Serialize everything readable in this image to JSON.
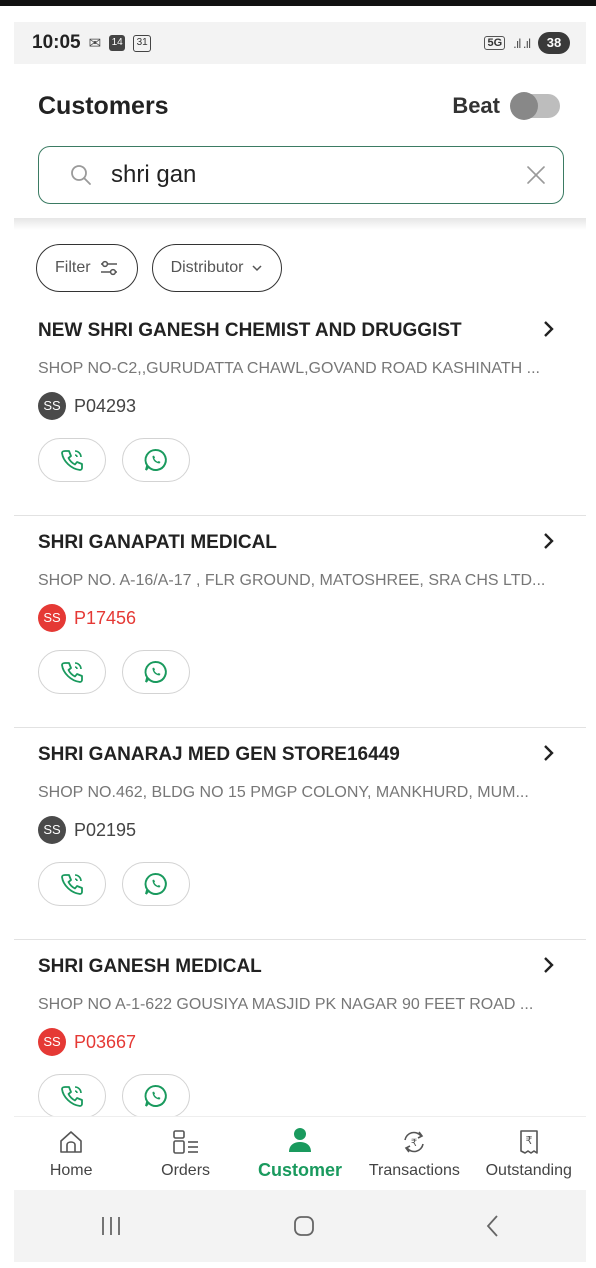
{
  "status_bar": {
    "time": "10:05",
    "notif_badge": "14",
    "calendar_day": "31",
    "network": "5G",
    "battery": "38"
  },
  "header": {
    "title": "Customers",
    "beat_label": "Beat",
    "beat_on": false
  },
  "search": {
    "value": "shri gan",
    "placeholder": ""
  },
  "filters": {
    "filter_label": "Filter",
    "distributor_label": "Distributor"
  },
  "customers": [
    {
      "name": "NEW SHRI GANESH CHEMIST AND DRUGGIST",
      "address": "SHOP NO-C2,,GURUDATTA CHAWL,GOVAND ROAD KASHINATH ...",
      "initials": "SS",
      "code": "P04293",
      "status_color": "#4a4a4a"
    },
    {
      "name": "SHRI GANAPATI MEDICAL",
      "address": "SHOP NO. A-16/A-17 , FLR GROUND, MATOSHREE, SRA CHS LTD...",
      "initials": "SS",
      "code": "P17456",
      "status_color": "#e53935"
    },
    {
      "name": "SHRI GANARAJ MED GEN STORE16449",
      "address": "SHOP NO.462, BLDG NO 15 PMGP COLONY, MANKHURD, MUM...",
      "initials": "SS",
      "code": "P02195",
      "status_color": "#4a4a4a"
    },
    {
      "name": "SHRI GANESH MEDICAL",
      "address": "SHOP NO A-1-622 GOUSIYA MASJID PK NAGAR 90 FEET ROAD ...",
      "initials": "SS",
      "code": "P03667",
      "status_color": "#e53935"
    }
  ],
  "bottom_nav": [
    {
      "label": "Home",
      "icon": "home-icon",
      "active": false
    },
    {
      "label": "Orders",
      "icon": "orders-icon",
      "active": false
    },
    {
      "label": "Customer",
      "icon": "customer-icon",
      "active": true
    },
    {
      "label": "Transactions",
      "icon": "transactions-icon",
      "active": false
    },
    {
      "label": "Outstanding",
      "icon": "outstanding-icon",
      "active": false
    }
  ],
  "colors": {
    "accent_green": "#1a9a5e",
    "search_border": "#3b7b63",
    "status_red": "#e53935",
    "status_dark": "#4a4a4a"
  }
}
